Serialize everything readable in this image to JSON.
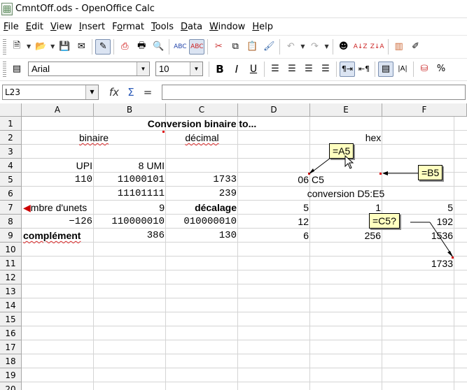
{
  "window": {
    "title": "CmntOff.ods - OpenOffice Calc",
    "icon": "calc-document-icon"
  },
  "menu": [
    {
      "label": "File",
      "key": "F",
      "rest": "ile"
    },
    {
      "label": "Edit",
      "key": "E",
      "rest": "dit"
    },
    {
      "label": "View",
      "key": "V",
      "rest": "iew"
    },
    {
      "label": "Insert",
      "key": "I",
      "rest": "nsert"
    },
    {
      "label": "Format",
      "key": "o",
      "pre": "F",
      "rest": "rmat"
    },
    {
      "label": "Tools",
      "key": "T",
      "rest": "ools"
    },
    {
      "label": "Data",
      "key": "D",
      "rest": "ata"
    },
    {
      "label": "Window",
      "key": "W",
      "rest": "indow"
    },
    {
      "label": "Help",
      "key": "H",
      "rest": "elp"
    }
  ],
  "formatting": {
    "font_name": "Arial",
    "font_size": "10"
  },
  "formula_bar": {
    "cell_ref": "L23",
    "content": ""
  },
  "columns": [
    "A",
    "B",
    "C",
    "D",
    "E",
    "F"
  ],
  "rows": [
    "1",
    "2",
    "3",
    "4",
    "5",
    "6",
    "7",
    "8",
    "9",
    "10",
    "11",
    "12",
    "13",
    "14",
    "15",
    "16",
    "17",
    "18",
    "19",
    "20"
  ],
  "cells": {
    "title": "Conversion binaire to...",
    "A2": "binaire",
    "C2": "décimal",
    "E2": "hex",
    "A4": "UPI",
    "B4": "8 UMI",
    "A5": "110",
    "B5": "11000101",
    "C5": "1733",
    "D5": "06",
    "E5": "C5",
    "B6": "11101111",
    "C6": "239",
    "E6": "conversion D5:E5",
    "A7": "mbre d'unets",
    "B7": "9",
    "C7": "décalage",
    "D7": "5",
    "E7": "1",
    "F7": "5",
    "A8": "−126",
    "B8": "110000010",
    "C8": "010000010",
    "D8": "12",
    "F8": "192",
    "A9": "complément",
    "B9": "386",
    "C9": "130",
    "D9": "6",
    "E9": "256",
    "F9": "1536",
    "F11": "1733"
  },
  "comments": {
    "a5": "=A5",
    "b5": "=B5",
    "c5": "=C5?"
  },
  "colors": {
    "comment_bg": "#ffffc0",
    "comment_marker": "#e01010",
    "header_bg": "#f0f0f0"
  }
}
